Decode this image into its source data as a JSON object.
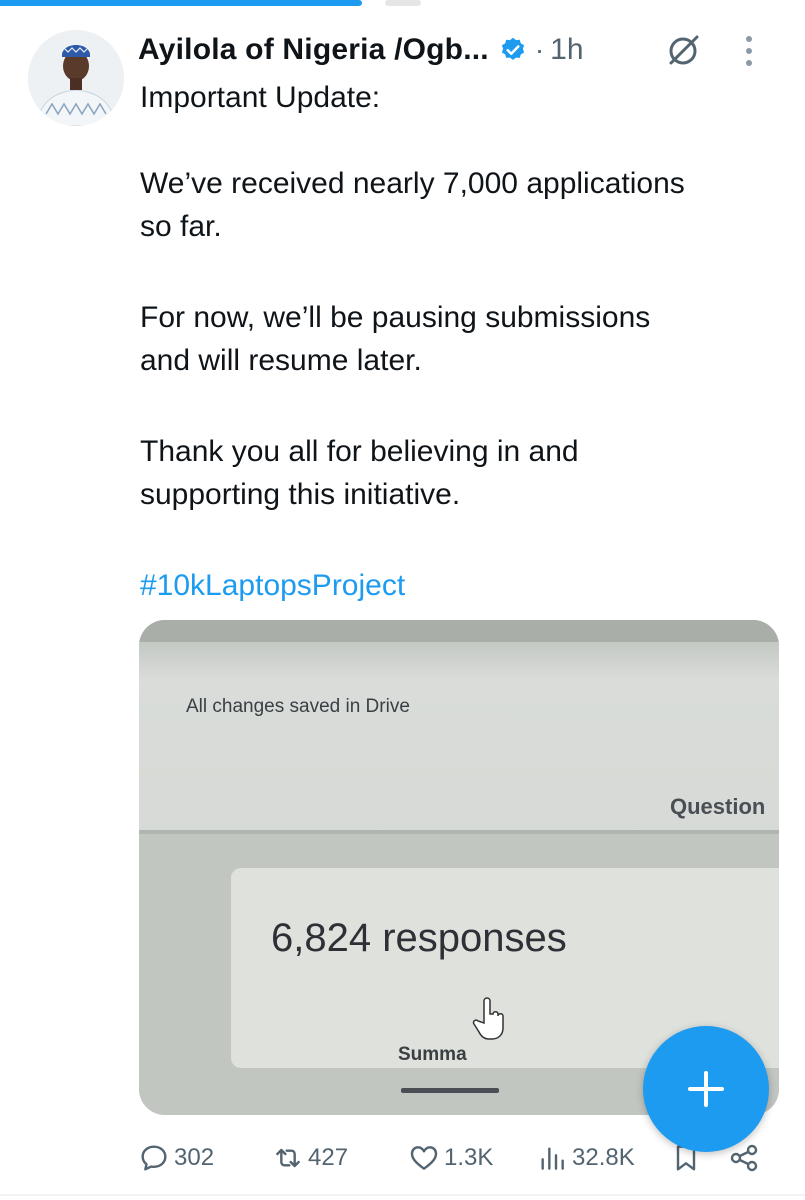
{
  "progress": {
    "fraction": 0.45
  },
  "tweet": {
    "author": "Ayilola of Nigeria /Ogb...",
    "separator": "·",
    "time": "1h",
    "lines": [
      "Important Update:",
      "We’ve received nearly 7,000 applications",
      "so far.",
      "For now, we’ll be pausing submissions",
      "and will resume later.",
      "Thank you all for believing in and",
      "supporting this initiative."
    ],
    "hashtag": "#10kLaptopsProject"
  },
  "media": {
    "saved_text": "All changes saved in Drive",
    "questions_tab": "Question",
    "responses": "6,824 responses",
    "summary_tab": "Summa"
  },
  "actions": {
    "replies": "302",
    "reposts": "427",
    "likes": "1.3K",
    "views": "32.8K"
  },
  "icons": [
    "verified-badge-icon",
    "grok-icon",
    "more-icon",
    "reply-icon",
    "repost-icon",
    "like-icon",
    "views-icon",
    "bookmark-icon",
    "share-icon",
    "plus-icon"
  ],
  "colors": {
    "accent": "#1d9bf0",
    "text": "#0f1419",
    "muted": "#536471"
  }
}
